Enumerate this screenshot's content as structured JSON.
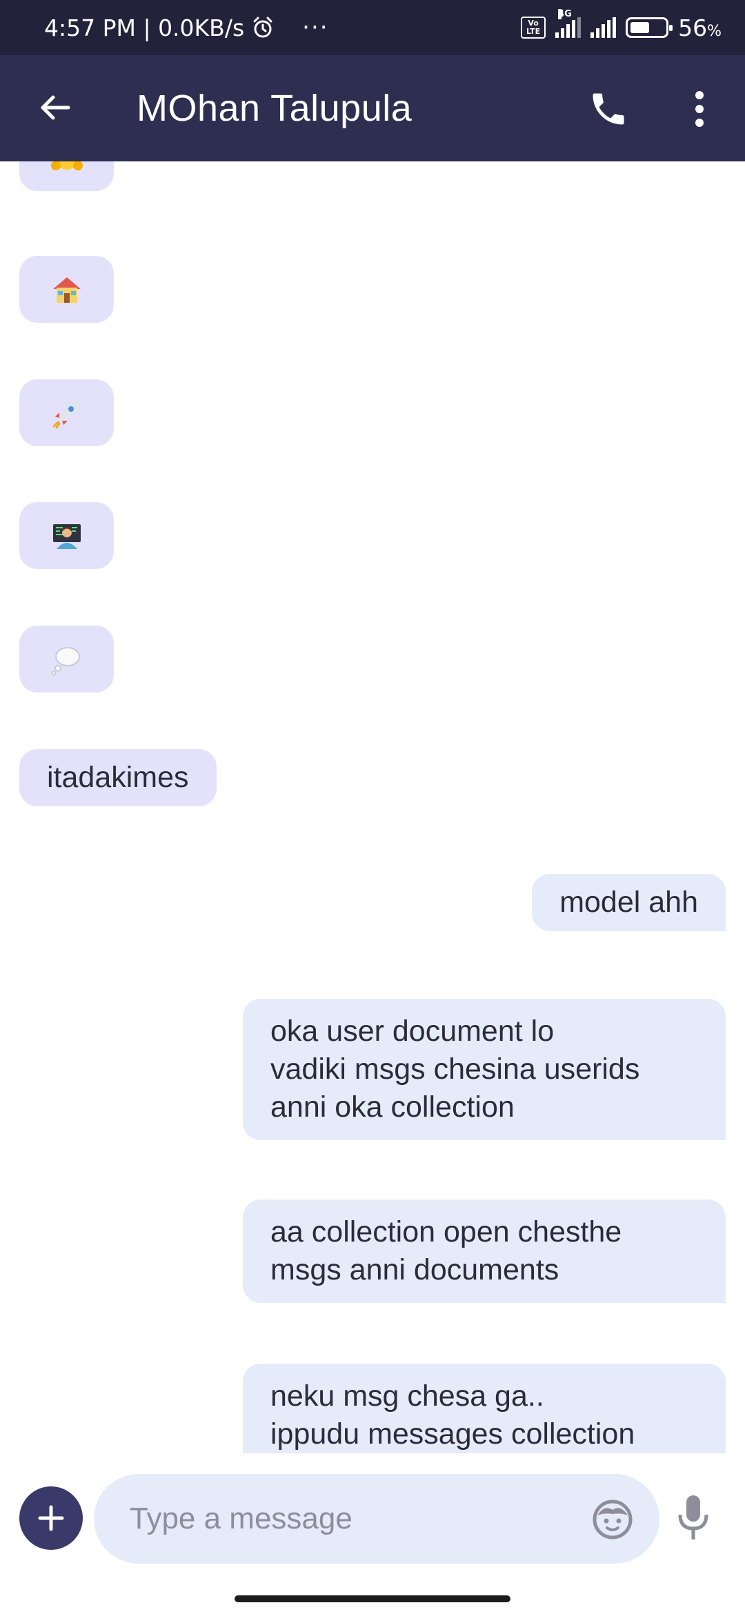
{
  "status_bar": {
    "time_speed": "4:57 PM | 0.0KB/s",
    "more": "···",
    "volte": "Vo LTE",
    "network": "4G",
    "battery_level": 0.56,
    "battery_percent": "56",
    "battery_unit": "%"
  },
  "header": {
    "contact_name": "MOhan Talupula"
  },
  "messages": {
    "emojis": [
      {
        "icon": "hugging-face"
      },
      {
        "icon": "house"
      },
      {
        "icon": "rocket"
      },
      {
        "icon": "technologist"
      },
      {
        "icon": "thought-balloon"
      }
    ],
    "m1": {
      "text": "itadakimes"
    },
    "m2": {
      "text": "model ahh"
    },
    "m3": {
      "lines": [
        "oka user document lo",
        "vadiki msgs chesina userids",
        "anni oka collection"
      ]
    },
    "m4": {
      "lines": [
        "aa collection open chesthe",
        "msgs anni documents"
      ]
    },
    "m5": {
      "lines": [
        "neku msg chesa ga..",
        "ippudu messages collection"
      ]
    }
  },
  "composer": {
    "placeholder": "Type a message"
  },
  "colors": {
    "status_bar": "#22223b",
    "app_bar": "#2e2e50",
    "incoming_bubble": "#e4e2fb",
    "outgoing_bubble": "#e6ebfa",
    "accent": "#3a3a6a"
  }
}
